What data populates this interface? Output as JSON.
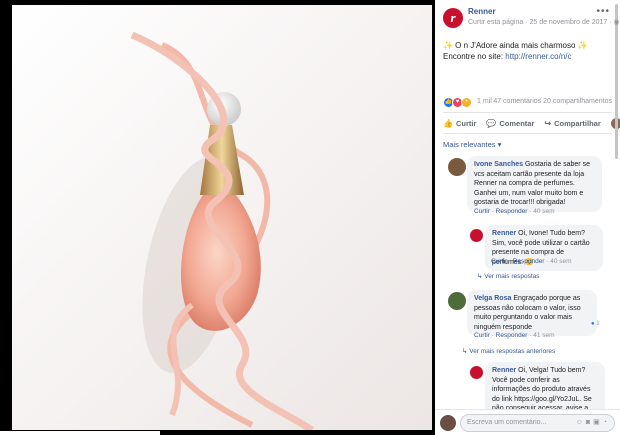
{
  "post": {
    "page_name": "Renner",
    "header_sub": "Curtir esta página · 25 de novembro de 2017 ·",
    "text_before_link": "✨ O n J'Adore ainda mais charmoso ✨ Encontre no site: ",
    "link": "http://renner.co/n/c",
    "reaction_count": "1 mil",
    "reaction_right": "47 comentários  20 compartilhamentos"
  },
  "actions": {
    "like": "Curtir",
    "comment": "Comentar",
    "share": "Compartilhar"
  },
  "relevance_label": "Mais relevantes ▾",
  "comments": [
    {
      "author": "Ivone Sanches",
      "text": "Gostaria de saber se vcs aceitam cartão presente da loja Renner na compra de perfumes. Ganhei um, num valor muito bom e gostaria de trocar!!! obrigada!",
      "like": "Curtir",
      "reply": "Responder",
      "time": "40 sem",
      "avatar_color": "#7a5a3e"
    },
    {
      "author": "Renner",
      "text": "Oi, Ivone! Tudo bem? Sim, você pode utilizar o cartão presente na compra de perfumes. 😊",
      "like": "Curtir",
      "reply": "Responder",
      "time": "40 sem",
      "avatar_color": "#c8102e"
    },
    {
      "author": "Velga Rosa",
      "text": "Engraçado porque as pessoas não colocam o valor, isso muito perguntando o valor mais ninguém responde",
      "like": "Curtir",
      "reply": "Responder",
      "time": "41 sem",
      "avatar_color": "#4d6b3b"
    },
    {
      "author": "Renner",
      "text": "Oi, Velga! Tudo bem? Você pode conferir as informações do produto através do link https://goo.gl/Yo2JuL. Se não conseguir acessar, avise a gente! 😊",
      "avatar_color": "#c8102e"
    }
  ],
  "reply_links": {
    "first": "Ver mais respostas",
    "second": "Ver mais respostas anteriores"
  },
  "like_count_small": "1",
  "composer": {
    "placeholder": "Escreva um comentário..."
  },
  "colors": {
    "brand": "#c8102e",
    "link": "#385898",
    "muted": "#90949c",
    "bubble": "#f2f3f5"
  }
}
